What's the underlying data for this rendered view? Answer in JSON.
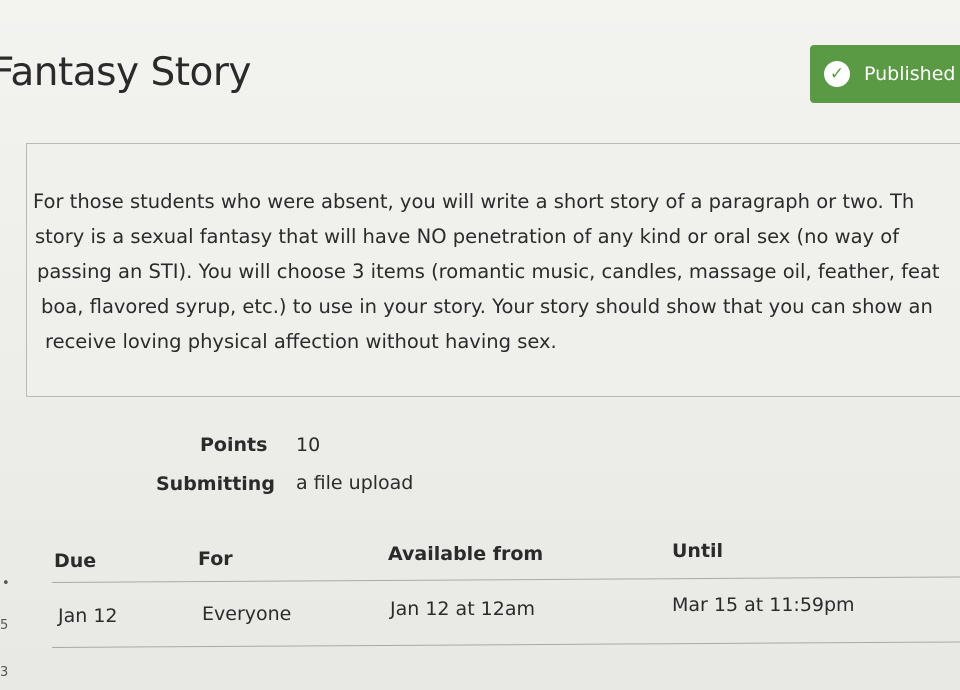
{
  "header": {
    "title": "Fantasy Story",
    "status_label": "Published",
    "status_color": "#5a9a44",
    "status_icon": "check-circle-icon"
  },
  "description": {
    "lines": [
      "For those students who were absent, you will write a short story of a paragraph or two. Th",
      "story is a sexual fantasy that will have NO penetration of any kind or oral sex (no way of",
      "passing an STI). You will choose 3 items (romantic music, candles, massage oil, feather, feat",
      "boa, flavored syrup, etc.) to use in your story. Your story should show that you can show an",
      "receive loving physical affection without having sex."
    ]
  },
  "details": {
    "points_label": "Points",
    "points_value": "10",
    "submitting_label": "Submitting",
    "submitting_value": "a file upload"
  },
  "dates_table": {
    "headers": [
      "Due",
      "For",
      "Available from",
      "Until"
    ],
    "rows": [
      [
        "Jan 12",
        "Everyone",
        "Jan 12 at 12am",
        "Mar 15 at 11:59pm"
      ]
    ]
  }
}
